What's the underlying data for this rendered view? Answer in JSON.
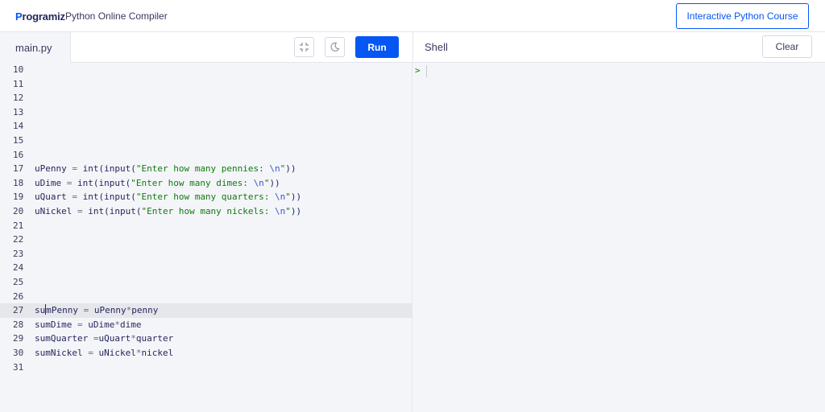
{
  "header": {
    "logo_text": "rogramiz",
    "logo_p": "P",
    "app_title": "Python Online Compiler",
    "course_button": "Interactive Python Course"
  },
  "editor": {
    "file_tab": "main.py",
    "run_label": "Run",
    "lines": [
      {
        "n": "10",
        "code": ""
      },
      {
        "n": "11",
        "code": ""
      },
      {
        "n": "12",
        "code": ""
      },
      {
        "n": "13",
        "code": ""
      },
      {
        "n": "14",
        "code": ""
      },
      {
        "n": "15",
        "code": ""
      },
      {
        "n": "16",
        "code": ""
      },
      {
        "n": "17",
        "pre": "uPenny ",
        "eq": "=",
        "mid": " int(input(",
        "str": "\"Enter how many pennies: ",
        "esc": "\\n",
        "end": "\"",
        "tail": "))"
      },
      {
        "n": "18",
        "pre": "uDime ",
        "eq": "=",
        "mid": " int(input(",
        "str": "\"Enter how many dimes: ",
        "esc": "\\n",
        "end": "\"",
        "tail": "))"
      },
      {
        "n": "19",
        "pre": "uQuart ",
        "eq": "=",
        "mid": " int(input(",
        "str": "\"Enter how many quarters: ",
        "esc": "\\n",
        "end": "\"",
        "tail": "))"
      },
      {
        "n": "20",
        "pre": "uNickel ",
        "eq": "=",
        "mid": " int(input(",
        "str": "\"Enter how many nickels: ",
        "esc": "\\n",
        "end": "\"",
        "tail": "))"
      },
      {
        "n": "21",
        "code": ""
      },
      {
        "n": "22",
        "code": ""
      },
      {
        "n": "23",
        "code": ""
      },
      {
        "n": "24",
        "code": ""
      },
      {
        "n": "25",
        "code": ""
      },
      {
        "n": "26",
        "code": ""
      },
      {
        "n": "27",
        "pre": "su",
        "post": "mPenny ",
        "eq": "=",
        "rest": " uPenny",
        "star": "*",
        "rest2": "penny"
      },
      {
        "n": "28",
        "pre": "sumDime ",
        "eq": "=",
        "rest": " uDime",
        "star": "*",
        "rest2": "dime"
      },
      {
        "n": "29",
        "pre": "sumQuarter ",
        "eq": "=",
        "rest": "uQuart",
        "star": "*",
        "rest2": "quarter"
      },
      {
        "n": "30",
        "pre": "sumNickel ",
        "eq": "=",
        "rest": " uNickel",
        "star": "*",
        "rest2": "nickel"
      },
      {
        "n": "31",
        "code": ""
      }
    ]
  },
  "shell": {
    "title": "Shell",
    "clear_label": "Clear",
    "prompt": ">"
  },
  "colors": {
    "accent": "#0556f3",
    "string": "#117a11",
    "escape": "#3657d6",
    "active_line": "#e6e7eb"
  }
}
